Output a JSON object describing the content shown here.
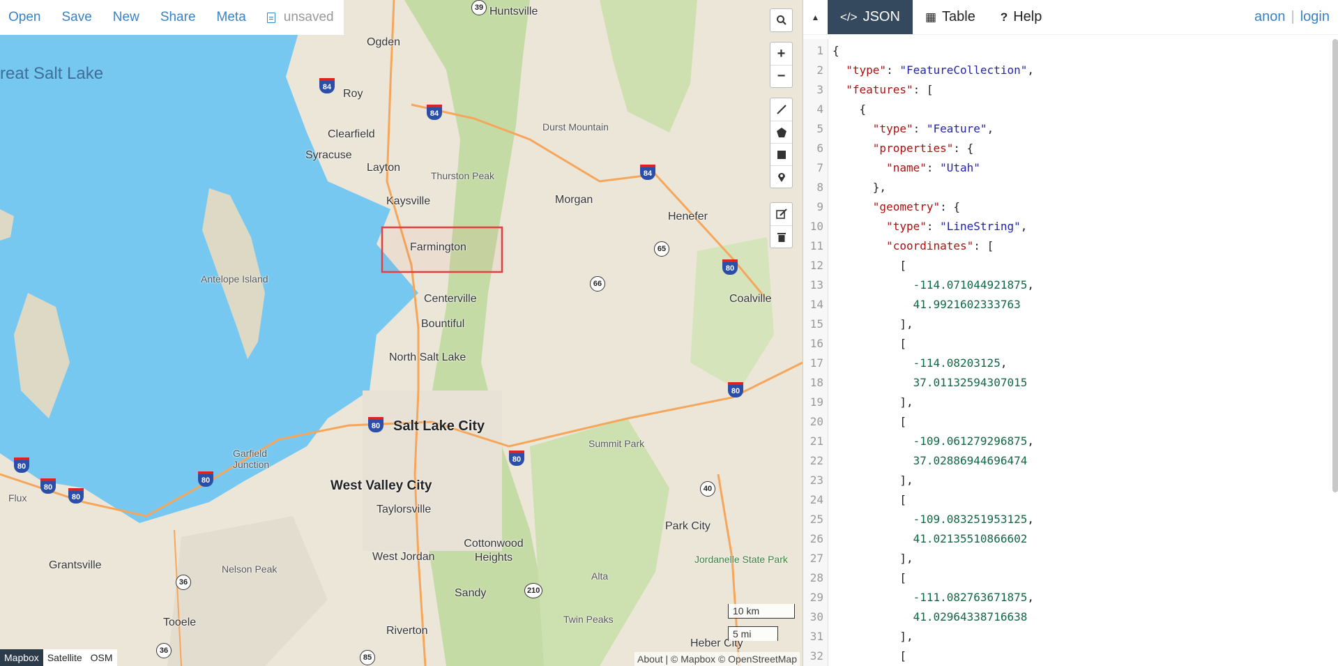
{
  "toolbar": {
    "links": [
      "Open",
      "Save",
      "New",
      "Share",
      "Meta"
    ],
    "status": "unsaved"
  },
  "map": {
    "places": [
      {
        "name": "Huntsville",
        "cls": ""
      },
      {
        "name": "Ogden",
        "cls": ""
      },
      {
        "name": "reat Salt Lake",
        "cls": "lake"
      },
      {
        "name": "Roy",
        "cls": ""
      },
      {
        "name": "Durst Mountain",
        "cls": "small"
      },
      {
        "name": "Clearfield",
        "cls": ""
      },
      {
        "name": "Syracuse",
        "cls": ""
      },
      {
        "name": "Layton",
        "cls": ""
      },
      {
        "name": "Thurston Peak",
        "cls": "small"
      },
      {
        "name": "Kaysville",
        "cls": ""
      },
      {
        "name": "Morgan",
        "cls": ""
      },
      {
        "name": "Henefer",
        "cls": ""
      },
      {
        "name": "Farmington",
        "cls": ""
      },
      {
        "name": "Antelope Island",
        "cls": "small"
      },
      {
        "name": "Centerville",
        "cls": ""
      },
      {
        "name": "Coalville",
        "cls": ""
      },
      {
        "name": "Bountiful",
        "cls": ""
      },
      {
        "name": "North Salt Lake",
        "cls": ""
      },
      {
        "name": "Salt Lake City",
        "cls": "big"
      },
      {
        "name": "Summit Park",
        "cls": "small"
      },
      {
        "name": "Garfield Junction",
        "cls": "small"
      },
      {
        "name": "West Valley City",
        "cls": "big"
      },
      {
        "name": "Flux",
        "cls": "small"
      },
      {
        "name": "Taylorsville",
        "cls": ""
      },
      {
        "name": "Park City",
        "cls": ""
      },
      {
        "name": "Cottonwood Heights",
        "cls": ""
      },
      {
        "name": "Jordanelle State Park",
        "cls": "park"
      },
      {
        "name": "Grantsville",
        "cls": ""
      },
      {
        "name": "Nelson Peak",
        "cls": "small"
      },
      {
        "name": "West Jordan",
        "cls": ""
      },
      {
        "name": "Alta",
        "cls": "small"
      },
      {
        "name": "Sandy",
        "cls": ""
      },
      {
        "name": "Twin Peaks",
        "cls": "small"
      },
      {
        "name": "Tooele",
        "cls": ""
      },
      {
        "name": "Riverton",
        "cls": ""
      },
      {
        "name": "Heber City",
        "cls": ""
      }
    ],
    "highways": [
      "39",
      "84",
      "84",
      "84",
      "65",
      "66",
      "80",
      "80",
      "80",
      "80",
      "80",
      "80",
      "80",
      "80",
      "40",
      "210",
      "36",
      "36",
      "85"
    ],
    "scale": {
      "km": "10 km",
      "mi": "5 mi"
    },
    "attribution": "About | © Mapbox © OpenStreetMap",
    "layers": [
      "Mapbox",
      "Satellite",
      "OSM"
    ],
    "active_layer": "Mapbox"
  },
  "pane": {
    "tabs": [
      "JSON",
      "Table",
      "Help"
    ],
    "active_tab": "JSON",
    "user": {
      "anon": "anon",
      "sep": "|",
      "login": "login"
    },
    "line_numbers": [
      "1",
      "2",
      "3",
      "4",
      "5",
      "6",
      "7",
      "8",
      "9",
      "10",
      "11",
      "12",
      "13",
      "14",
      "15",
      "16",
      "17",
      "18",
      "19",
      "20",
      "21",
      "22",
      "23",
      "24",
      "25",
      "26",
      "27",
      "28",
      "29",
      "30",
      "31",
      "32"
    ],
    "code": [
      [
        {
          "t": "p",
          "v": "{"
        }
      ],
      [
        {
          "t": "p",
          "v": "  "
        },
        {
          "t": "k",
          "v": "\"type\""
        },
        {
          "t": "p",
          "v": ": "
        },
        {
          "t": "s",
          "v": "\"FeatureCollection\""
        },
        {
          "t": "p",
          "v": ","
        }
      ],
      [
        {
          "t": "p",
          "v": "  "
        },
        {
          "t": "k",
          "v": "\"features\""
        },
        {
          "t": "p",
          "v": ": ["
        }
      ],
      [
        {
          "t": "p",
          "v": "    {"
        }
      ],
      [
        {
          "t": "p",
          "v": "      "
        },
        {
          "t": "k",
          "v": "\"type\""
        },
        {
          "t": "p",
          "v": ": "
        },
        {
          "t": "s",
          "v": "\"Feature\""
        },
        {
          "t": "p",
          "v": ","
        }
      ],
      [
        {
          "t": "p",
          "v": "      "
        },
        {
          "t": "k",
          "v": "\"properties\""
        },
        {
          "t": "p",
          "v": ": {"
        }
      ],
      [
        {
          "t": "p",
          "v": "        "
        },
        {
          "t": "k",
          "v": "\"name\""
        },
        {
          "t": "p",
          "v": ": "
        },
        {
          "t": "s",
          "v": "\"Utah\""
        }
      ],
      [
        {
          "t": "p",
          "v": "      },"
        }
      ],
      [
        {
          "t": "p",
          "v": "      "
        },
        {
          "t": "k",
          "v": "\"geometry\""
        },
        {
          "t": "p",
          "v": ": {"
        }
      ],
      [
        {
          "t": "p",
          "v": "        "
        },
        {
          "t": "k",
          "v": "\"type\""
        },
        {
          "t": "p",
          "v": ": "
        },
        {
          "t": "s",
          "v": "\"LineString\""
        },
        {
          "t": "p",
          "v": ","
        }
      ],
      [
        {
          "t": "p",
          "v": "        "
        },
        {
          "t": "k",
          "v": "\"coordinates\""
        },
        {
          "t": "p",
          "v": ": ["
        }
      ],
      [
        {
          "t": "p",
          "v": "          ["
        }
      ],
      [
        {
          "t": "p",
          "v": "            "
        },
        {
          "t": "n",
          "v": "-114.071044921875"
        },
        {
          "t": "p",
          "v": ","
        }
      ],
      [
        {
          "t": "p",
          "v": "            "
        },
        {
          "t": "n",
          "v": "41.9921602333763"
        }
      ],
      [
        {
          "t": "p",
          "v": "          ],"
        }
      ],
      [
        {
          "t": "p",
          "v": "          ["
        }
      ],
      [
        {
          "t": "p",
          "v": "            "
        },
        {
          "t": "n",
          "v": "-114.08203125"
        },
        {
          "t": "p",
          "v": ","
        }
      ],
      [
        {
          "t": "p",
          "v": "            "
        },
        {
          "t": "n",
          "v": "37.01132594307015"
        }
      ],
      [
        {
          "t": "p",
          "v": "          ],"
        }
      ],
      [
        {
          "t": "p",
          "v": "          ["
        }
      ],
      [
        {
          "t": "p",
          "v": "            "
        },
        {
          "t": "n",
          "v": "-109.061279296875"
        },
        {
          "t": "p",
          "v": ","
        }
      ],
      [
        {
          "t": "p",
          "v": "            "
        },
        {
          "t": "n",
          "v": "37.02886944696474"
        }
      ],
      [
        {
          "t": "p",
          "v": "          ],"
        }
      ],
      [
        {
          "t": "p",
          "v": "          ["
        }
      ],
      [
        {
          "t": "p",
          "v": "            "
        },
        {
          "t": "n",
          "v": "-109.083251953125"
        },
        {
          "t": "p",
          "v": ","
        }
      ],
      [
        {
          "t": "p",
          "v": "            "
        },
        {
          "t": "n",
          "v": "41.02135510866602"
        }
      ],
      [
        {
          "t": "p",
          "v": "          ],"
        }
      ],
      [
        {
          "t": "p",
          "v": "          ["
        }
      ],
      [
        {
          "t": "p",
          "v": "            "
        },
        {
          "t": "n",
          "v": "-111.082763671875"
        },
        {
          "t": "p",
          "v": ","
        }
      ],
      [
        {
          "t": "p",
          "v": "            "
        },
        {
          "t": "n",
          "v": "41.02964338716638"
        }
      ],
      [
        {
          "t": "p",
          "v": "          ],"
        }
      ],
      [
        {
          "t": "p",
          "v": "          ["
        }
      ]
    ]
  },
  "colors": {
    "water": "#76c8f0",
    "land": "#ece6d8",
    "forest": "#c5dba6",
    "road": "#f5a65b",
    "accent": "#3a82c4",
    "active_tab": "#34495e",
    "selection": "#e04040"
  }
}
